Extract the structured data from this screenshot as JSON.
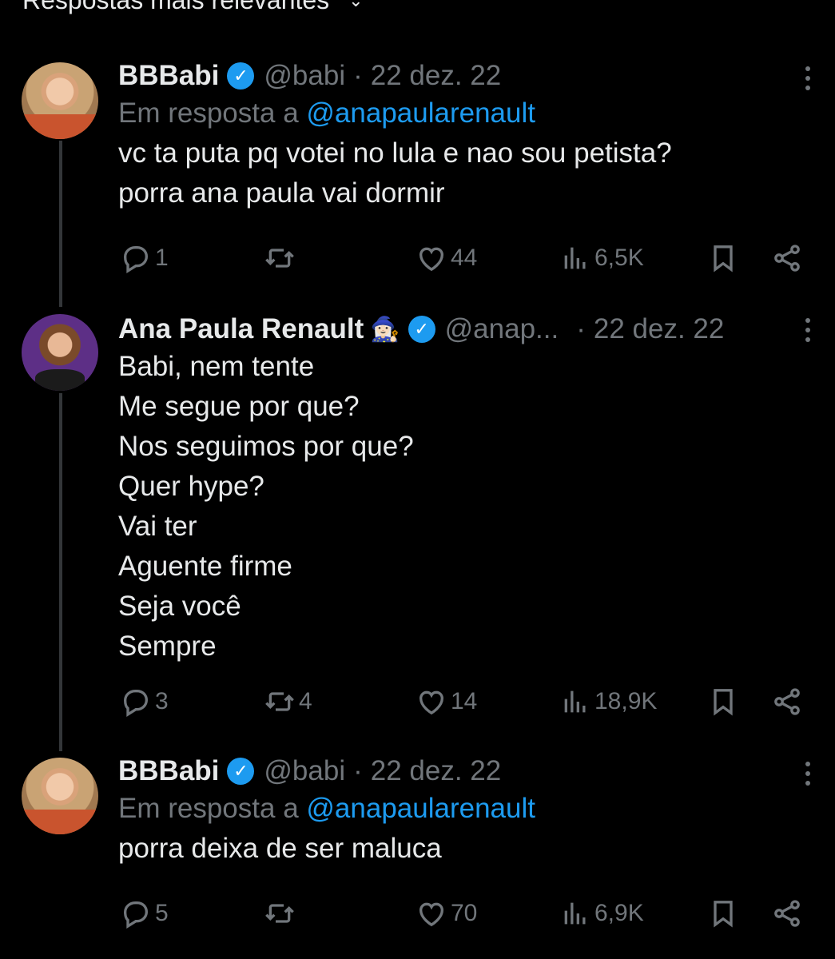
{
  "header": {
    "label": "Respostas mais relevantes"
  },
  "tweets": [
    {
      "name": "BBBabi",
      "emoji": "",
      "handle": "@babi",
      "date": "22 dez. 22",
      "reply_prefix": "Em resposta a",
      "reply_to": "@anapaularenault",
      "lines": [
        "vc ta puta pq votei no lula e nao sou petista?",
        "porra ana paula vai dormir"
      ],
      "replies": "1",
      "reposts": "",
      "likes": "44",
      "views": "6,5K"
    },
    {
      "name": "Ana Paula Renault",
      "emoji": "🧙🏻‍♀️",
      "handle": "@anap...",
      "date": "22 dez. 22",
      "reply_prefix": "",
      "reply_to": "",
      "lines": [
        "Babi, nem tente",
        "Me segue por que?",
        "Nos seguimos por que?",
        "Quer hype?",
        "Vai ter",
        "Aguente firme",
        "Seja você",
        "Sempre"
      ],
      "replies": "3",
      "reposts": "4",
      "likes": "14",
      "views": "18,9K"
    },
    {
      "name": "BBBabi",
      "emoji": "",
      "handle": "@babi",
      "date": "22 dez. 22",
      "reply_prefix": "Em resposta a",
      "reply_to": "@anapaularenault",
      "lines": [
        "porra deixa de ser maluca"
      ],
      "replies": "5",
      "reposts": "",
      "likes": "70",
      "views": "6,9K"
    }
  ],
  "colors": {
    "background": "#000000",
    "accent": "#1d9bf0",
    "muted": "#71767b",
    "text": "#e7e9ea"
  },
  "icons": [
    "reply-icon",
    "repost-icon",
    "like-icon",
    "views-icon",
    "bookmark-icon",
    "share-icon",
    "verified-badge-icon",
    "more-icon"
  ]
}
